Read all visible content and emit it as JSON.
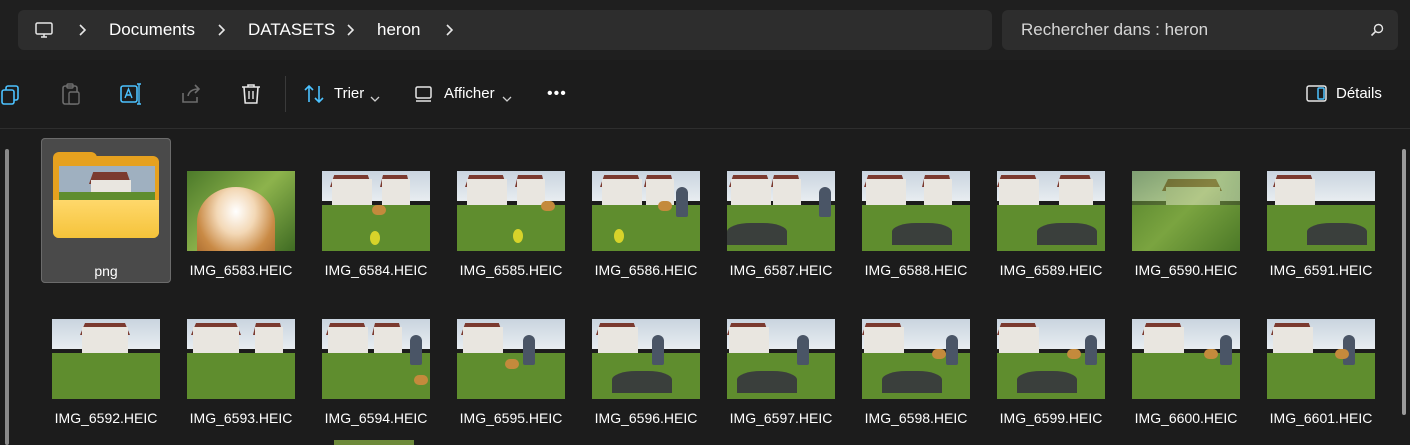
{
  "address_bar": {
    "breadcrumbs": [
      "Documents",
      "DATASETS",
      "heron"
    ],
    "search_placeholder": "Rechercher dans : heron"
  },
  "toolbar": {
    "sort_label": "Trier",
    "view_label": "Afficher",
    "more_label": "•••",
    "details_label": "Détails"
  },
  "files": {
    "folder": {
      "name": "png"
    },
    "row1": [
      "IMG_6583.HEIC",
      "IMG_6584.HEIC",
      "IMG_6585.HEIC",
      "IMG_6586.HEIC",
      "IMG_6587.HEIC",
      "IMG_6588.HEIC",
      "IMG_6589.HEIC",
      "IMG_6590.HEIC",
      "IMG_6591.HEIC"
    ],
    "row2": [
      "IMG_6592.HEIC",
      "IMG_6593.HEIC",
      "IMG_6594.HEIC",
      "IMG_6595.HEIC",
      "IMG_6596.HEIC",
      "IMG_6597.HEIC",
      "IMG_6598.HEIC",
      "IMG_6599.HEIC",
      "IMG_6600.HEIC",
      "IMG_6601.HEIC"
    ]
  },
  "colors": {
    "accent": "#4cc2ff",
    "folder": "#f5c33a",
    "background": "#1c1c1c"
  }
}
